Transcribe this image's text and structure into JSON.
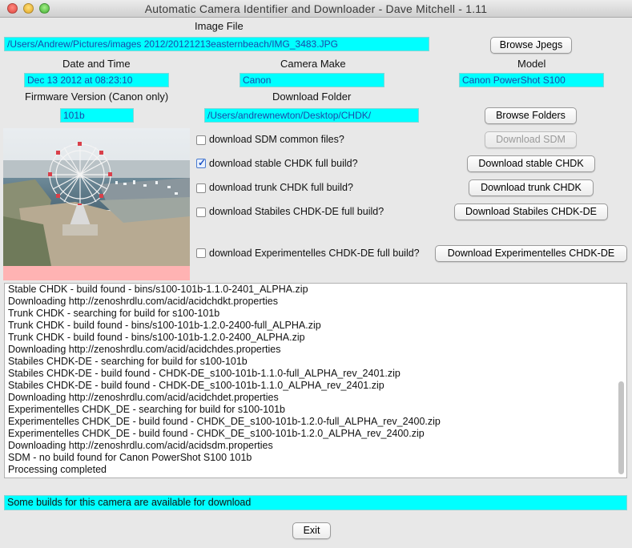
{
  "window": {
    "title": "Automatic Camera Identifier and Downloader - Dave Mitchell - 1.11"
  },
  "image_file": {
    "label": "Image File",
    "value": "/Users/Andrew/Pictures/images 2012/20121213easternbeach/IMG_3483.JPG",
    "browse_label": "Browse Jpegs"
  },
  "date_time": {
    "label": "Date and Time",
    "value": "Dec 13 2012 at 08:23:10"
  },
  "camera_make": {
    "label": "Camera Make",
    "value": "Canon"
  },
  "model": {
    "label": "Model",
    "value": "Canon PowerShot S100"
  },
  "firmware": {
    "label": "Firmware Version (Canon only)",
    "value": "101b"
  },
  "download_folder": {
    "label": "Download Folder",
    "value": "/Users/andrewnewton/Desktop/CHDK/",
    "browse_label": "Browse Folders"
  },
  "options": [
    {
      "label": "download SDM common files?",
      "checked": false,
      "button": "Download SDM",
      "enabled": false
    },
    {
      "label": "download stable CHDK full build?",
      "checked": true,
      "button": "Download stable CHDK",
      "enabled": true
    },
    {
      "label": "download trunk CHDK full build?",
      "checked": false,
      "button": "Download trunk CHDK",
      "enabled": true
    },
    {
      "label": "download Stabiles CHDK-DE full build?",
      "checked": false,
      "button": "Download Stabiles CHDK-DE",
      "enabled": true
    },
    {
      "label": "download Experimentelles CHDK-DE full build?",
      "checked": false,
      "button": "Download Experimentelles CHDK-DE",
      "enabled": true
    }
  ],
  "log": [
    "Stable CHDK - build found - bins/s100-101b-1.1.0-2401_ALPHA.zip",
    "Downloading http://zenoshrdlu.com/acid/acidchdkt.properties",
    "Trunk CHDK - searching for build for s100-101b",
    "Trunk CHDK - build found - bins/s100-101b-1.2.0-2400-full_ALPHA.zip",
    "Trunk CHDK - build found - bins/s100-101b-1.2.0-2400_ALPHA.zip",
    "Downloading http://zenoshrdlu.com/acid/acidchdes.properties",
    "Stabiles CHDK-DE - searching for build for s100-101b",
    "Stabiles CHDK-DE - build found - CHDK-DE_s100-101b-1.1.0-full_ALPHA_rev_2401.zip",
    "Stabiles CHDK-DE - build found - CHDK-DE_s100-101b-1.1.0_ALPHA_rev_2401.zip",
    "Downloading http://zenoshrdlu.com/acid/acidchdet.properties",
    "Experimentelles CHDK_DE - searching for build for s100-101b",
    "Experimentelles CHDK_DE - build found - CHDK_DE_s100-101b-1.2.0-full_ALPHA_rev_2400.zip",
    "Experimentelles CHDK_DE - build found - CHDK_DE_s100-101b-1.2.0_ALPHA_rev_2400.zip",
    "Downloading http://zenoshrdlu.com/acid/acidsdm.properties",
    "SDM - no build found for Canon PowerShot S100 101b",
    "Processing completed"
  ],
  "status": "Some builds for this camera are available for download",
  "exit_label": "Exit",
  "colors": {
    "field_bg": "#00ffff",
    "photo_placeholder": "#ffb3b3"
  },
  "icons": [
    "close-icon",
    "minimize-icon",
    "zoom-icon",
    "checkmark-icon"
  ]
}
